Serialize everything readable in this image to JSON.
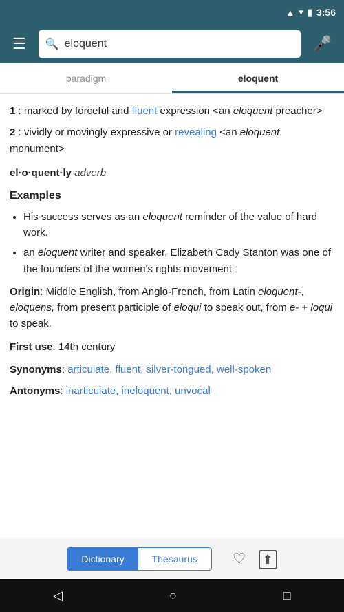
{
  "status_bar": {
    "time": "3:56",
    "signal_icon": "▲",
    "wifi_icon": "▾",
    "battery_icon": "🔋"
  },
  "search": {
    "placeholder": "eloquent",
    "value": "eloquent",
    "search_icon": "🔍",
    "mic_icon": "🎤"
  },
  "hamburger": "☰",
  "tabs": [
    {
      "label": "paradigm",
      "active": false
    },
    {
      "label": "eloquent",
      "active": true
    }
  ],
  "content": {
    "def1_label": "1",
    "def1_colon": " : ",
    "def1_text_before": "marked by forceful and ",
    "def1_link": "fluent",
    "def1_text_after": " expression <an ",
    "def1_italic": "eloquent",
    "def1_text_end": " preacher>",
    "def2_label": "2",
    "def2_colon": " : ",
    "def2_text_before": "vividly or movingly expressive or ",
    "def2_link": "revealing",
    "def2_text_after": " <an ",
    "def2_italic": "eloquent",
    "def2_text_end": " monument>",
    "adverb_word": "el·o·quent·ly",
    "adverb_pos": "adverb",
    "examples_title": "Examples",
    "examples": [
      "His success serves as an eloquent reminder of the value of hard work.",
      "an eloquent writer and speaker, Elizabeth Cady Stanton was one of the founders of the women's rights movement"
    ],
    "origin_label": "Origin",
    "origin_text": ": Middle English, from Anglo-French, from Latin eloquent-, eloquens, from present participle of eloqui to speak out, from e- + loqui to speak.",
    "first_use_label": "First use",
    "first_use_text": ": 14th century",
    "synonyms_label": "Synonyms",
    "synonyms_links": "articulate, fluent, silver-tongued, well-spoken",
    "antonyms_label": "Antonyms",
    "antonyms_links": "inarticulate, ineloquent, unvocal"
  },
  "bottom": {
    "dict_label": "Dictionary",
    "thes_label": "Thesaurus",
    "heart_icon": "♡",
    "share_icon": "⬆"
  },
  "nav": {
    "back_icon": "◁",
    "home_icon": "○",
    "recent_icon": "□"
  }
}
